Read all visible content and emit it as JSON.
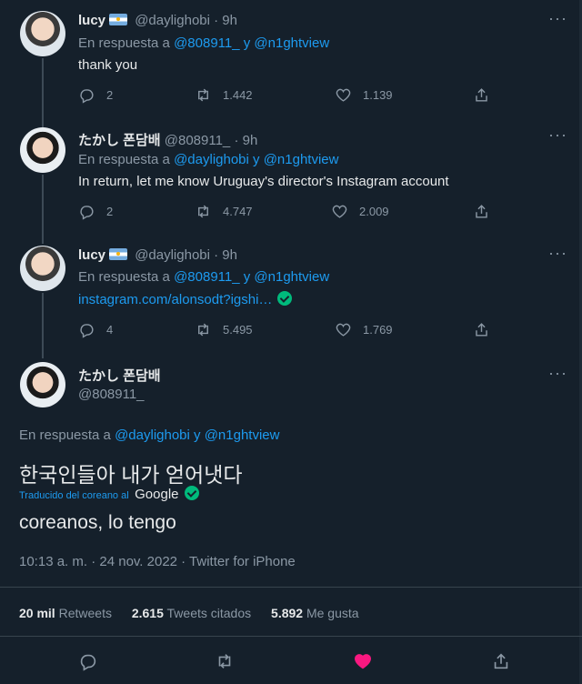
{
  "tweets": [
    {
      "name": "lucy",
      "handle": "@daylighobi",
      "time": "· 9h",
      "reply_prefix": "En respuesta a",
      "reply_to": "@808911_ y @n1ghtview",
      "text": "thank you",
      "replies": "2",
      "retweets": "1.442",
      "likes": "1.139"
    },
    {
      "name": "たかし 폰담배",
      "handle": "@808911_",
      "time": "· 9h",
      "reply_prefix": "En respuesta a",
      "reply_to": "@daylighobi y @n1ghtview",
      "text": "In return, let me know Uruguay's director's Instagram account",
      "replies": "2",
      "retweets": "4.747",
      "likes": "2.009"
    },
    {
      "name": "lucy",
      "handle": "@daylighobi",
      "time": "· 9h",
      "reply_prefix": "En respuesta a",
      "reply_to": "@808911_ y @n1ghtview",
      "text": "instagram.com/alonsodt?igshi…",
      "replies": "4",
      "retweets": "5.495",
      "likes": "1.769"
    }
  ],
  "main": {
    "name": "たかし 폰담배",
    "handle": "@808911_",
    "reply_prefix": "En respuesta a",
    "reply_to": "@daylighobi y @n1ghtview",
    "original_text": "한국인들아 내가 얻어냇다",
    "translated_by": "Traducido del coreano al",
    "translator": "Google",
    "translated_text": "coreanos, lo tengo",
    "timestamp": "10:13 a. m. · 24 nov. 2022 · Twitter for iPhone",
    "retweets_count": "20 mil",
    "retweets_label": "Retweets",
    "quotes_count": "2.615",
    "quotes_label": "Tweets citados",
    "likes_count": "5.892",
    "likes_label": "Me gusta"
  },
  "colors": {
    "background": "#15202b",
    "link": "#1d9bf0",
    "like_active": "#f91880",
    "verified": "#00ba7c"
  }
}
